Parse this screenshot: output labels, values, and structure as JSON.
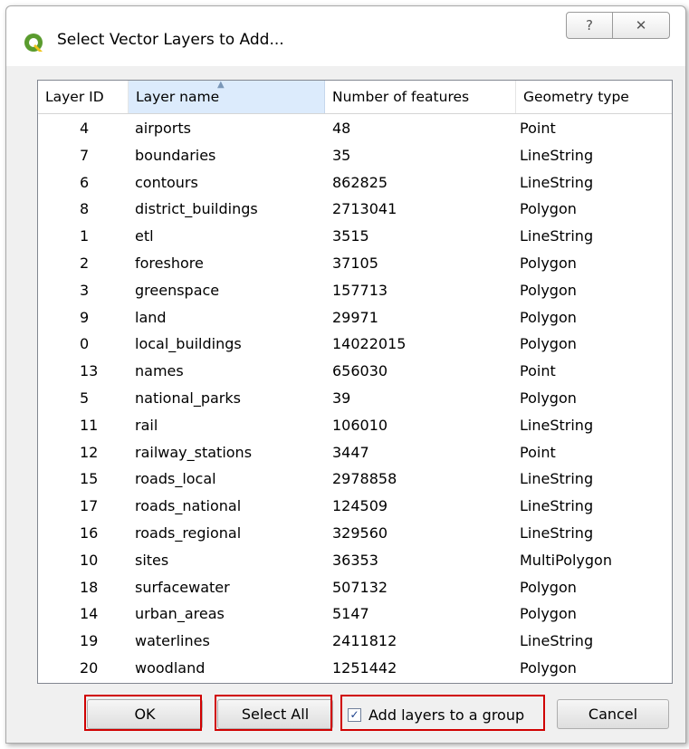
{
  "window": {
    "title": "Select Vector Layers to Add...",
    "help_glyph": "?",
    "close_glyph": "✕"
  },
  "table": {
    "headers": [
      "Layer ID",
      "Layer name",
      "Number of features",
      "Geometry type"
    ],
    "sorted_column": "Layer name",
    "rows": [
      [
        "4",
        "airports",
        "48",
        "Point"
      ],
      [
        "7",
        "boundaries",
        "35",
        "LineString"
      ],
      [
        "6",
        "contours",
        "862825",
        "LineString"
      ],
      [
        "8",
        "district_buildings",
        "2713041",
        "Polygon"
      ],
      [
        "1",
        "etl",
        "3515",
        "LineString"
      ],
      [
        "2",
        "foreshore",
        "37105",
        "Polygon"
      ],
      [
        "3",
        "greenspace",
        "157713",
        "Polygon"
      ],
      [
        "9",
        "land",
        "29971",
        "Polygon"
      ],
      [
        "0",
        "local_buildings",
        "14022015",
        "Polygon"
      ],
      [
        "13",
        "names",
        "656030",
        "Point"
      ],
      [
        "5",
        "national_parks",
        "39",
        "Polygon"
      ],
      [
        "11",
        "rail",
        "106010",
        "LineString"
      ],
      [
        "12",
        "railway_stations",
        "3447",
        "Point"
      ],
      [
        "15",
        "roads_local",
        "2978858",
        "LineString"
      ],
      [
        "17",
        "roads_national",
        "124509",
        "LineString"
      ],
      [
        "16",
        "roads_regional",
        "329560",
        "LineString"
      ],
      [
        "10",
        "sites",
        "36353",
        "MultiPolygon"
      ],
      [
        "18",
        "surfacewater",
        "507132",
        "Polygon"
      ],
      [
        "14",
        "urban_areas",
        "5147",
        "Polygon"
      ],
      [
        "19",
        "waterlines",
        "2411812",
        "LineString"
      ],
      [
        "20",
        "woodland",
        "1251442",
        "Polygon"
      ]
    ]
  },
  "buttons": {
    "ok": "OK",
    "select_all": "Select All",
    "cancel": "Cancel"
  },
  "checkbox": {
    "label": "Add layers to a group",
    "checked": true,
    "check_glyph": "✓"
  },
  "colors": {
    "highlight_frame": "#d00000",
    "qgis_green": "#5a9b2e",
    "sorted_header_bg": "#dcebfc"
  },
  "icons": {
    "app": "qgis-logo-icon",
    "help": "help-icon",
    "close": "close-icon",
    "sort": "sort-ascending-icon"
  }
}
